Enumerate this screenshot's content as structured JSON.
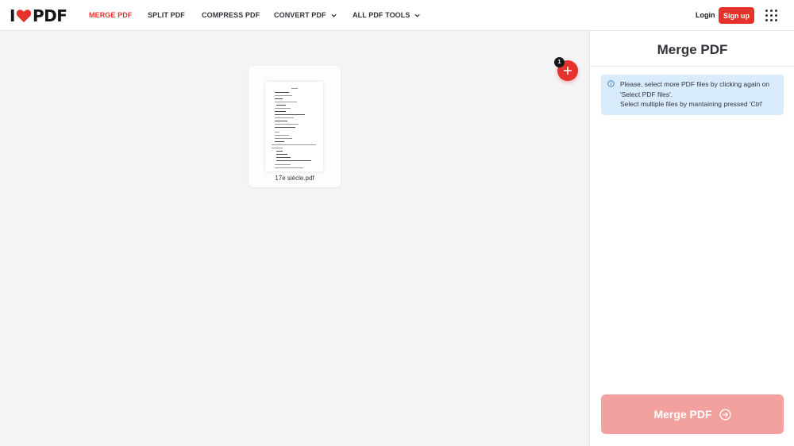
{
  "header": {
    "logo_left": "I",
    "logo_right": "PDF",
    "nav": [
      {
        "label": "MERGE PDF",
        "active": true,
        "dropdown": false
      },
      {
        "label": "SPLIT PDF",
        "active": false,
        "dropdown": false
      },
      {
        "label": "COMPRESS PDF",
        "active": false,
        "dropdown": false
      },
      {
        "label": "CONVERT PDF",
        "active": false,
        "dropdown": true
      },
      {
        "label": "ALL PDF TOOLS",
        "active": false,
        "dropdown": true
      }
    ],
    "login_label": "Login",
    "signup_label": "Sign up",
    "apps_icon": "grid-icon"
  },
  "files": [
    {
      "name": "17e siècle.pdf"
    }
  ],
  "add": {
    "count": "1",
    "icon": "plus-icon"
  },
  "sidebar": {
    "title": "Merge PDF",
    "info_lines": [
      "Please, select more PDF files by clicking again on",
      "'Select PDF files'.",
      "Select multiple files by mantaining pressed 'Ctrl'"
    ],
    "merge_button_label": "Merge PDF"
  },
  "colors": {
    "brand_red": "#e5322d",
    "merge_button_disabled": "#f2a19e",
    "info_bg": "#d9ecfb"
  }
}
